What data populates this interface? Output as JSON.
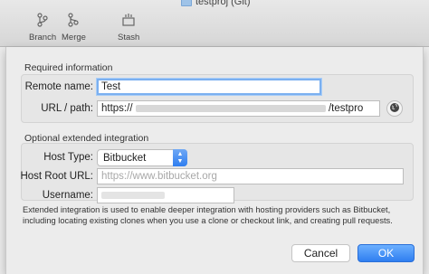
{
  "window": {
    "title": "testproj (Git)"
  },
  "toolbar": {
    "branch_label": "Branch",
    "merge_label": "Merge",
    "stash_label": "Stash"
  },
  "required": {
    "title": "Required information",
    "remote_name_label": "Remote name:",
    "remote_name_value": "Test",
    "url_label": "URL / path:",
    "url_prefix": "https://",
    "url_suffix": "/testpro"
  },
  "optional": {
    "title": "Optional extended integration",
    "host_type_label": "Host Type:",
    "host_type_value": "Bitbucket",
    "host_root_label": "Host Root URL:",
    "host_root_placeholder": "https://www.bitbucket.org",
    "username_label": "Username:",
    "help_text": "Extended integration is used to enable deeper integration with hosting providers such as Bitbucket, including locating existing clones when you use a clone or checkout link, and creating pull requests."
  },
  "buttons": {
    "cancel_label": "Cancel",
    "ok_label": "OK"
  },
  "colors": {
    "accent": "#2f7ef0",
    "focus_ring": "#7bb0f0"
  }
}
